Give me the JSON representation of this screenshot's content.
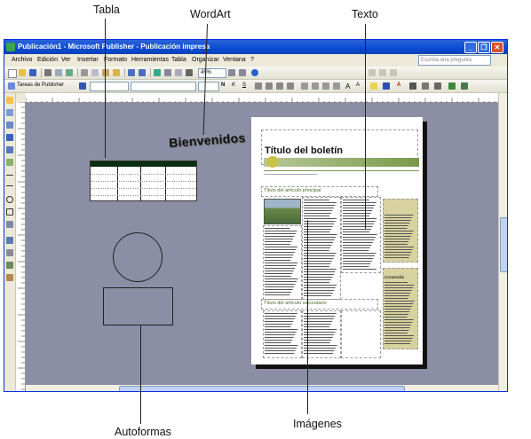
{
  "callouts": {
    "tabla": "Tabla",
    "wordart": "WordArt",
    "texto": "Texto",
    "imagenes": "Imágenes",
    "autoformas": "Autoformas"
  },
  "window": {
    "title": "Publicación1 - Microsoft Publisher - Publicación impresa",
    "title_color": "#0a4bd3"
  },
  "menu": {
    "items": [
      "Archivo",
      "Edición",
      "Ver",
      "Insertar",
      "Formato",
      "Herramientas",
      "Tabla",
      "Organizar",
      "Ventana",
      "?"
    ],
    "ask_placeholder": "Escriba una pregunta"
  },
  "toolbar": {
    "zoom": "45%",
    "tasks_label": "Tareas de Publisher"
  },
  "canvas": {
    "wordart_text": "Bienvenidos",
    "workspace_color": "#8b8ea4"
  },
  "newsletter": {
    "title": "Título del boletín",
    "primary_heading": "Título del artículo principal",
    "secondary_heading": "Título del artículo secundario",
    "sidebar_heading": "Contenido",
    "accent_color": "#7a9a4a"
  }
}
